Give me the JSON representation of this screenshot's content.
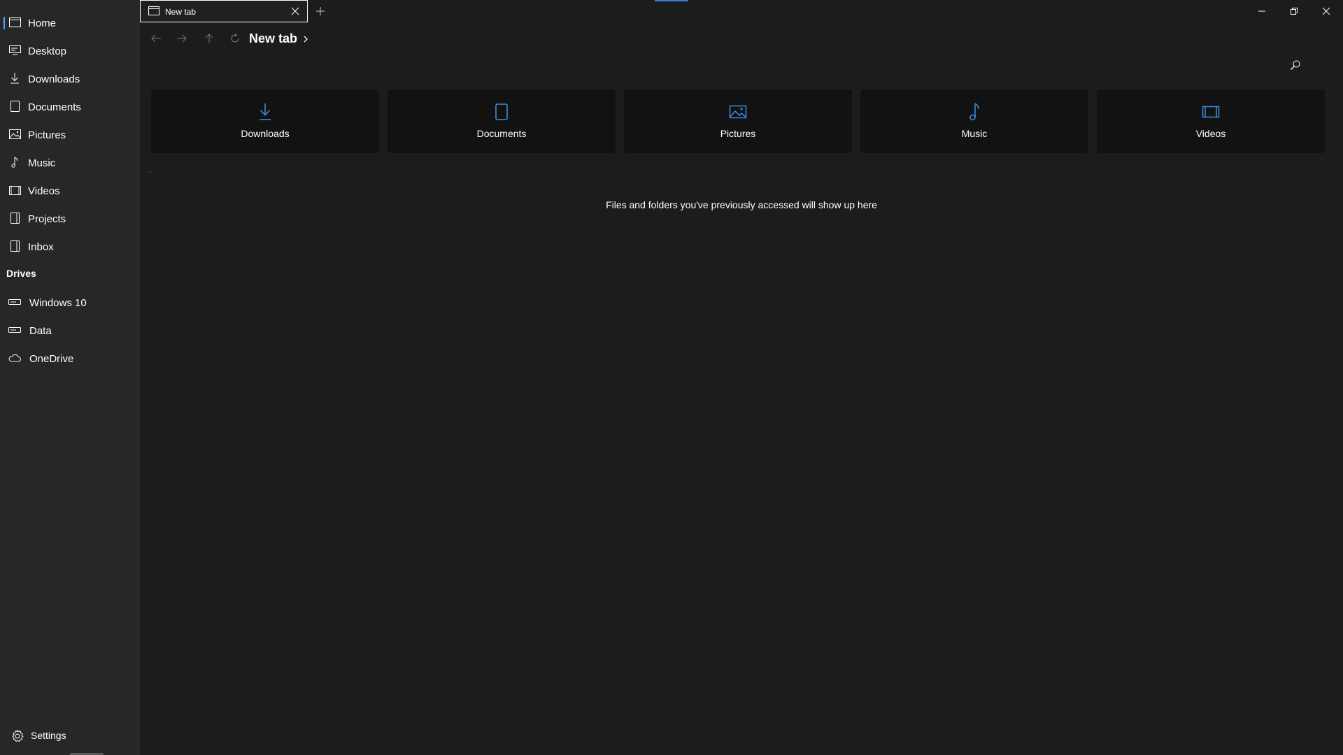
{
  "sidebar": {
    "items": [
      {
        "label": "Home",
        "icon": "home-icon",
        "active": true
      },
      {
        "label": "Desktop",
        "icon": "desktop-icon"
      },
      {
        "label": "Downloads",
        "icon": "download-icon"
      },
      {
        "label": "Documents",
        "icon": "document-icon"
      },
      {
        "label": "Pictures",
        "icon": "picture-icon"
      },
      {
        "label": "Music",
        "icon": "music-note-icon"
      },
      {
        "label": "Videos",
        "icon": "video-icon"
      },
      {
        "label": "Projects",
        "icon": "folder-icon"
      },
      {
        "label": "Inbox",
        "icon": "folder-icon"
      }
    ],
    "drives_header": "Drives",
    "drives": [
      {
        "label": "Windows 10",
        "icon": "drive-icon"
      },
      {
        "label": "Data",
        "icon": "drive-icon"
      },
      {
        "label": "OneDrive",
        "icon": "cloud-icon"
      }
    ],
    "settings_label": "Settings"
  },
  "tabbar": {
    "tabs": [
      {
        "title": "New tab"
      }
    ]
  },
  "toolbar": {
    "breadcrumb": "New tab"
  },
  "quick_access": [
    {
      "label": "Downloads",
      "icon": "download-icon"
    },
    {
      "label": "Documents",
      "icon": "document-icon"
    },
    {
      "label": "Pictures",
      "icon": "picture-icon"
    },
    {
      "label": "Music",
      "icon": "music-note-icon"
    },
    {
      "label": "Videos",
      "icon": "video-icon"
    }
  ],
  "recent": {
    "empty_message": "Files and folders you've previously accessed will show up here"
  },
  "colors": {
    "accent": "#3b8bdd",
    "sidebar_bg": "#272727",
    "content_bg": "#1c1c1c",
    "card_bg": "#121212"
  }
}
